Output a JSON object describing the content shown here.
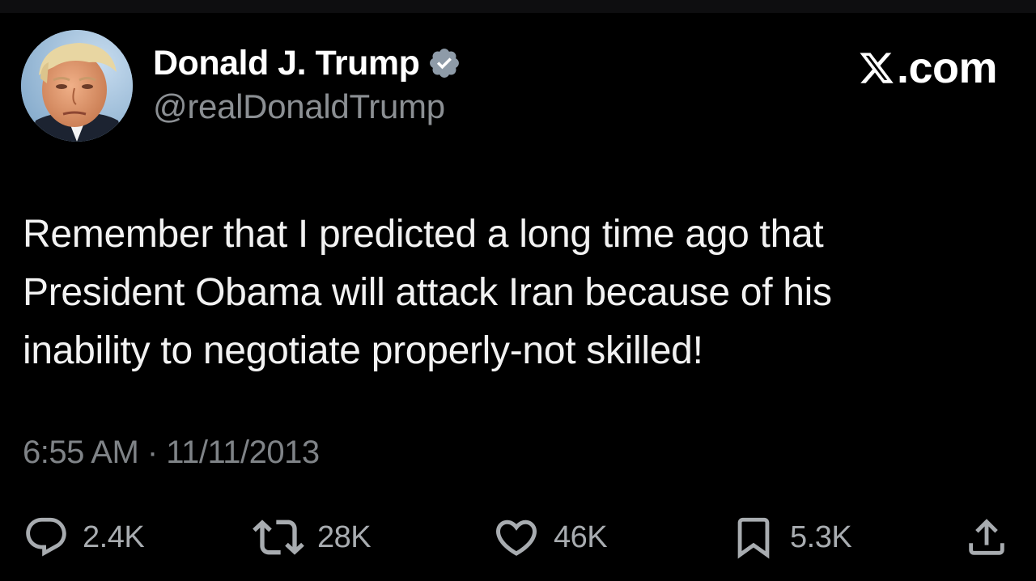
{
  "author": {
    "name": "Donald J. Trump",
    "handle": "@realDonaldTrump",
    "verified": true
  },
  "brand": {
    "text": ".com",
    "icon": "x-logo-icon"
  },
  "tweet": {
    "lines": [
      "Remember that I predicted a long time ago that",
      "President Obama will attack Iran because of his",
      "inability to negotiate properly-not skilled!"
    ],
    "timestamp": "6:55 AM · 11/11/2013"
  },
  "actions": {
    "reply": {
      "icon": "reply-icon",
      "count": "2.4K"
    },
    "repost": {
      "icon": "repost-icon",
      "count": "28K"
    },
    "like": {
      "icon": "heart-icon",
      "count": "46K"
    },
    "bookmark": {
      "icon": "bookmark-icon",
      "count": "5.3K"
    },
    "share": {
      "icon": "share-icon"
    }
  },
  "colors": {
    "background": "#000000",
    "text_primary": "#ffffff",
    "text_secondary": "#8b8f93",
    "verified_badge": "#8e9ba8",
    "action_icon": "#a8acb0"
  }
}
